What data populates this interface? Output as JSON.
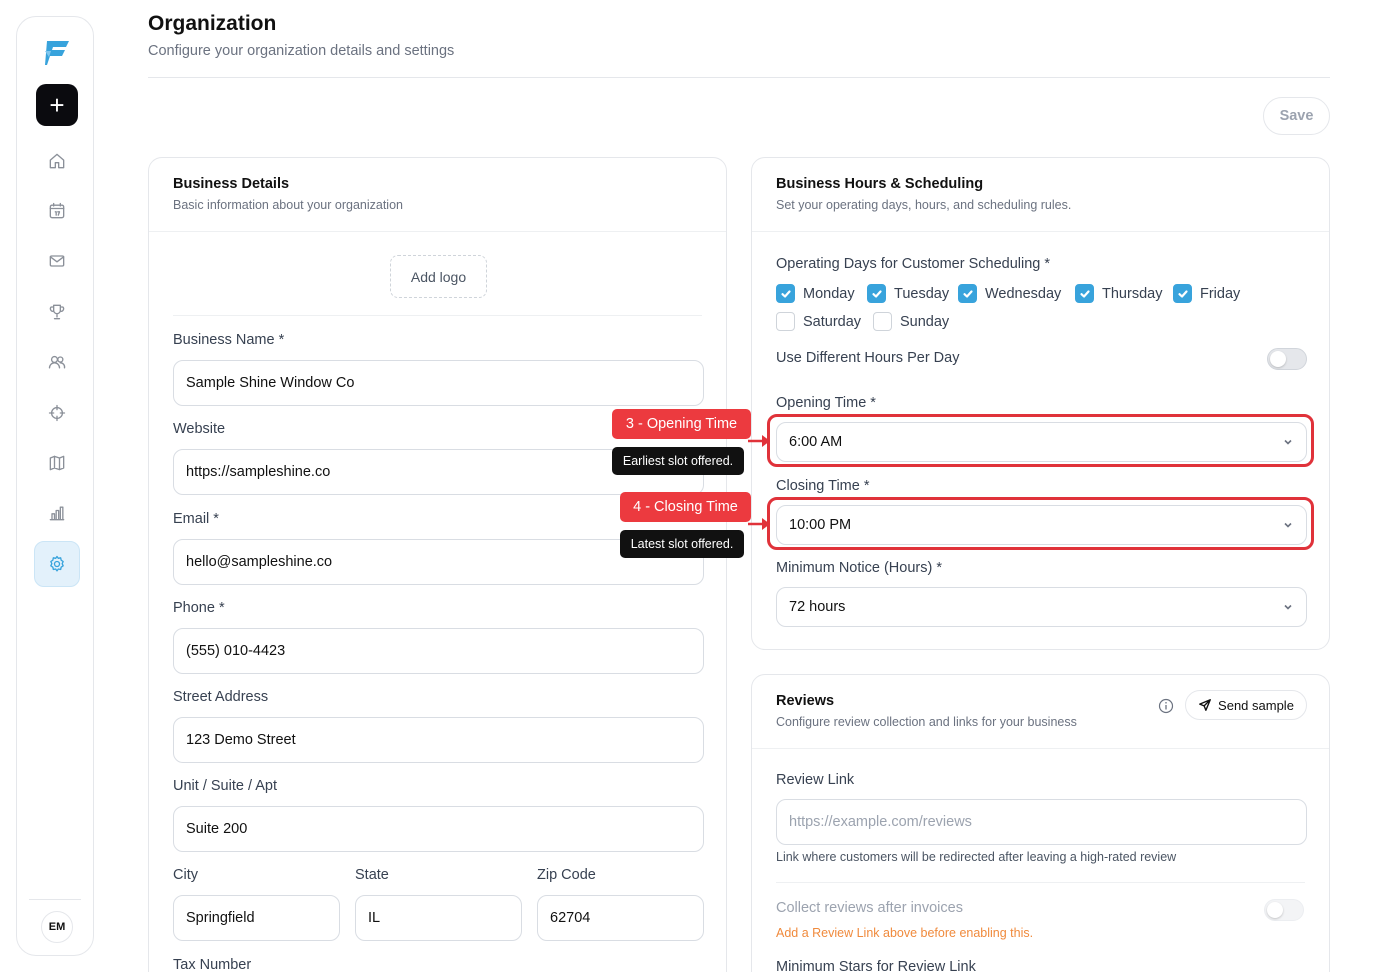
{
  "sidebar": {
    "new_label": "+",
    "items": [
      {
        "name": "home-icon"
      },
      {
        "name": "calendar-icon"
      },
      {
        "name": "mail-icon"
      },
      {
        "name": "trophy-icon"
      },
      {
        "name": "users-icon"
      },
      {
        "name": "crosshair-icon"
      },
      {
        "name": "map-icon"
      },
      {
        "name": "chart-icon"
      },
      {
        "name": "gear-icon",
        "active": true
      }
    ],
    "avatar_initials": "EM"
  },
  "header": {
    "title": "Organization",
    "subtitle": "Configure your organization details and settings",
    "save_label": "Save"
  },
  "business_details": {
    "title": "Business Details",
    "description": "Basic information about your organization",
    "add_logo_label": "Add logo",
    "fields": {
      "business_name": {
        "label": "Business Name *",
        "value": "Sample Shine Window Co"
      },
      "website": {
        "label": "Website",
        "value": "https://sampleshine.co"
      },
      "email": {
        "label": "Email *",
        "value": "hello@sampleshine.co"
      },
      "phone": {
        "label": "Phone *",
        "value": "(555) 010-4423"
      },
      "street": {
        "label": "Street Address",
        "value": "123 Demo Street"
      },
      "unit": {
        "label": "Unit / Suite / Apt",
        "value": "Suite 200"
      },
      "city": {
        "label": "City",
        "value": "Springfield"
      },
      "state": {
        "label": "State",
        "value": "IL"
      },
      "zip": {
        "label": "Zip Code",
        "value": "62704"
      },
      "tax": {
        "label": "Tax Number"
      }
    }
  },
  "hours": {
    "title": "Business Hours & Scheduling",
    "description": "Set your operating days, hours, and scheduling rules.",
    "operating_days_label": "Operating Days for Customer Scheduling *",
    "days": [
      {
        "label": "Monday",
        "checked": true
      },
      {
        "label": "Tuesday",
        "checked": true
      },
      {
        "label": "Wednesday",
        "checked": true
      },
      {
        "label": "Thursday",
        "checked": true
      },
      {
        "label": "Friday",
        "checked": true
      },
      {
        "label": "Saturday",
        "checked": false
      },
      {
        "label": "Sunday",
        "checked": false
      }
    ],
    "different_hours_label": "Use Different Hours Per Day",
    "different_hours_on": false,
    "opening": {
      "label": "Opening Time *",
      "value": "6:00 AM"
    },
    "closing": {
      "label": "Closing Time *",
      "value": "10:00 PM"
    },
    "notice": {
      "label": "Minimum Notice (Hours) *",
      "value": "72 hours"
    }
  },
  "annotations": {
    "opening_callout": "3 - Opening Time",
    "opening_tip": "Earliest slot offered.",
    "closing_callout": "4 - Closing Time",
    "closing_tip": "Latest slot offered.",
    "color": "#ec3a3f"
  },
  "reviews": {
    "title": "Reviews",
    "description": "Configure review collection and links for your business",
    "send_sample_label": "Send sample",
    "review_link": {
      "label": "Review Link",
      "placeholder": "https://example.com/reviews"
    },
    "helper": "Link where customers will be redirected after leaving a high-rated review",
    "collect_label": "Collect reviews after invoices",
    "collect_on": false,
    "warning": "Add a Review Link above before enabling this.",
    "min_stars_label": "Minimum Stars for Review Link"
  },
  "colors": {
    "accent": "#38a3dc",
    "dark": "#0b0b0f",
    "warning": "#f08a3c"
  }
}
